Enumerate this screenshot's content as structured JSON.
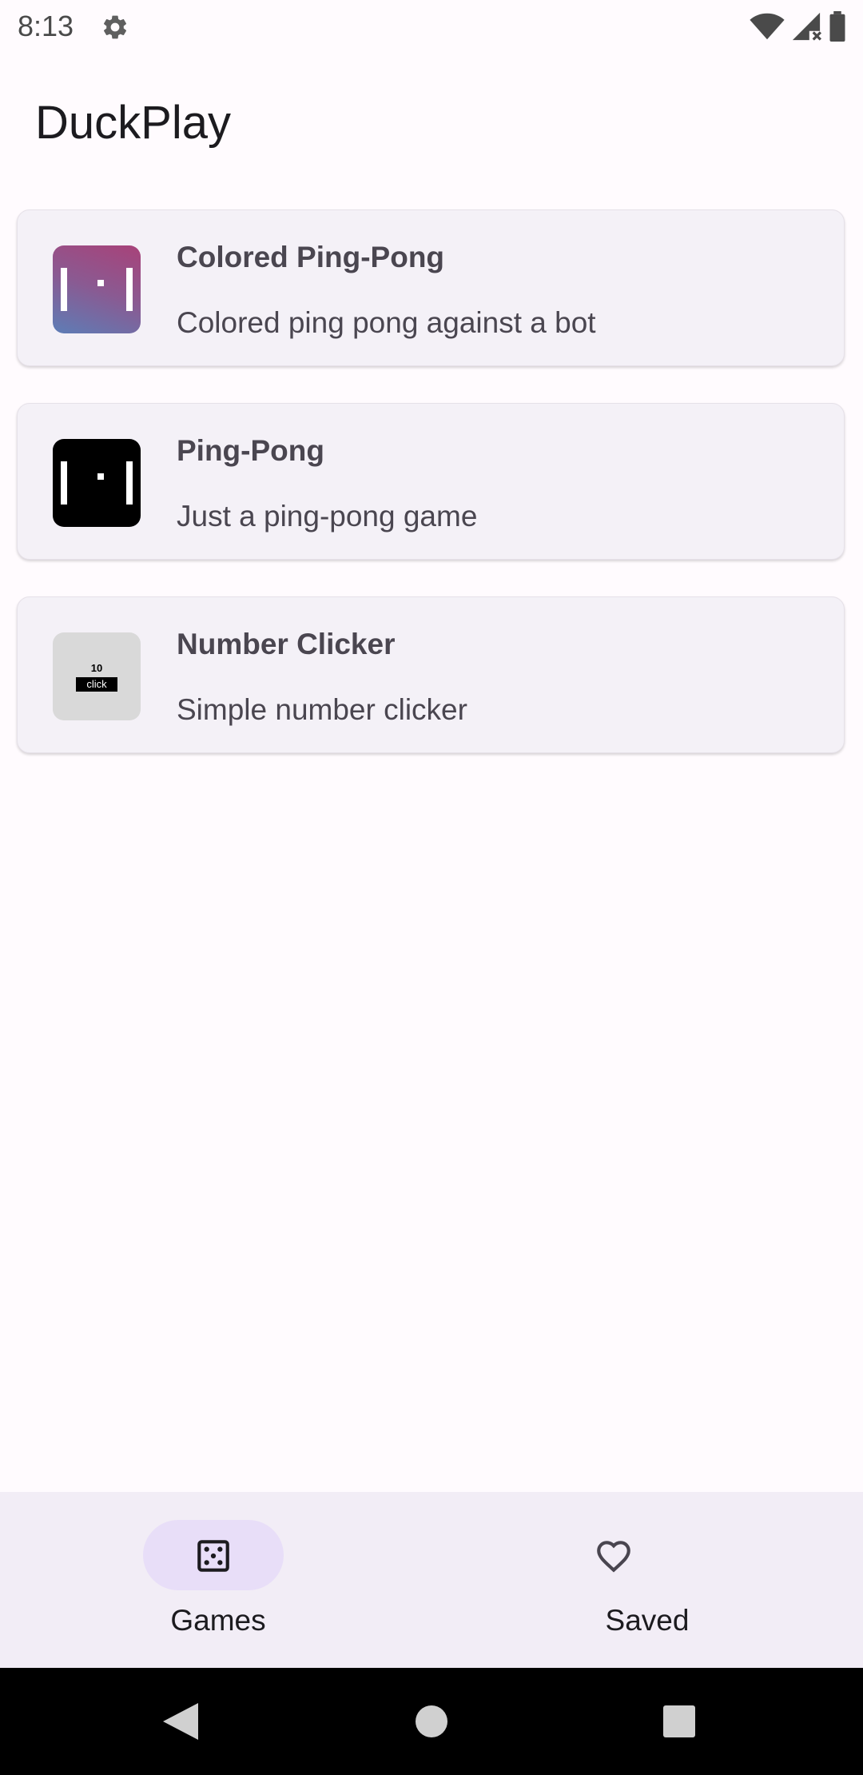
{
  "status_bar": {
    "time": "8:13",
    "icons": [
      "gear-icon",
      "wifi-icon",
      "signal-icon",
      "battery-icon"
    ]
  },
  "app": {
    "title": "DuckPlay"
  },
  "games": [
    {
      "name": "Colored Ping-Pong",
      "description": "Colored ping pong against a bot",
      "icon": "colored-ping-pong-icon"
    },
    {
      "name": "Ping-Pong",
      "description": "Just a ping-pong game",
      "icon": "ping-pong-icon"
    },
    {
      "name": "Number Clicker",
      "description": "Simple number clicker",
      "icon": "number-clicker-icon",
      "icon_number": "10",
      "icon_button": "click"
    }
  ],
  "bottom_nav": {
    "items": [
      {
        "label": "Games",
        "icon": "dice-icon",
        "selected": true
      },
      {
        "label": "Saved",
        "icon": "heart-icon",
        "selected": false
      }
    ]
  },
  "system_nav": {
    "buttons": [
      "back-icon",
      "home-icon",
      "recents-icon"
    ]
  },
  "colors": {
    "background": "#fffbfe",
    "card": "#f4f1f7",
    "nav_background": "#f2edf6",
    "nav_active_pill": "#e8def8",
    "text_primary": "#1c1b1f",
    "text_secondary": "#4a4650"
  }
}
